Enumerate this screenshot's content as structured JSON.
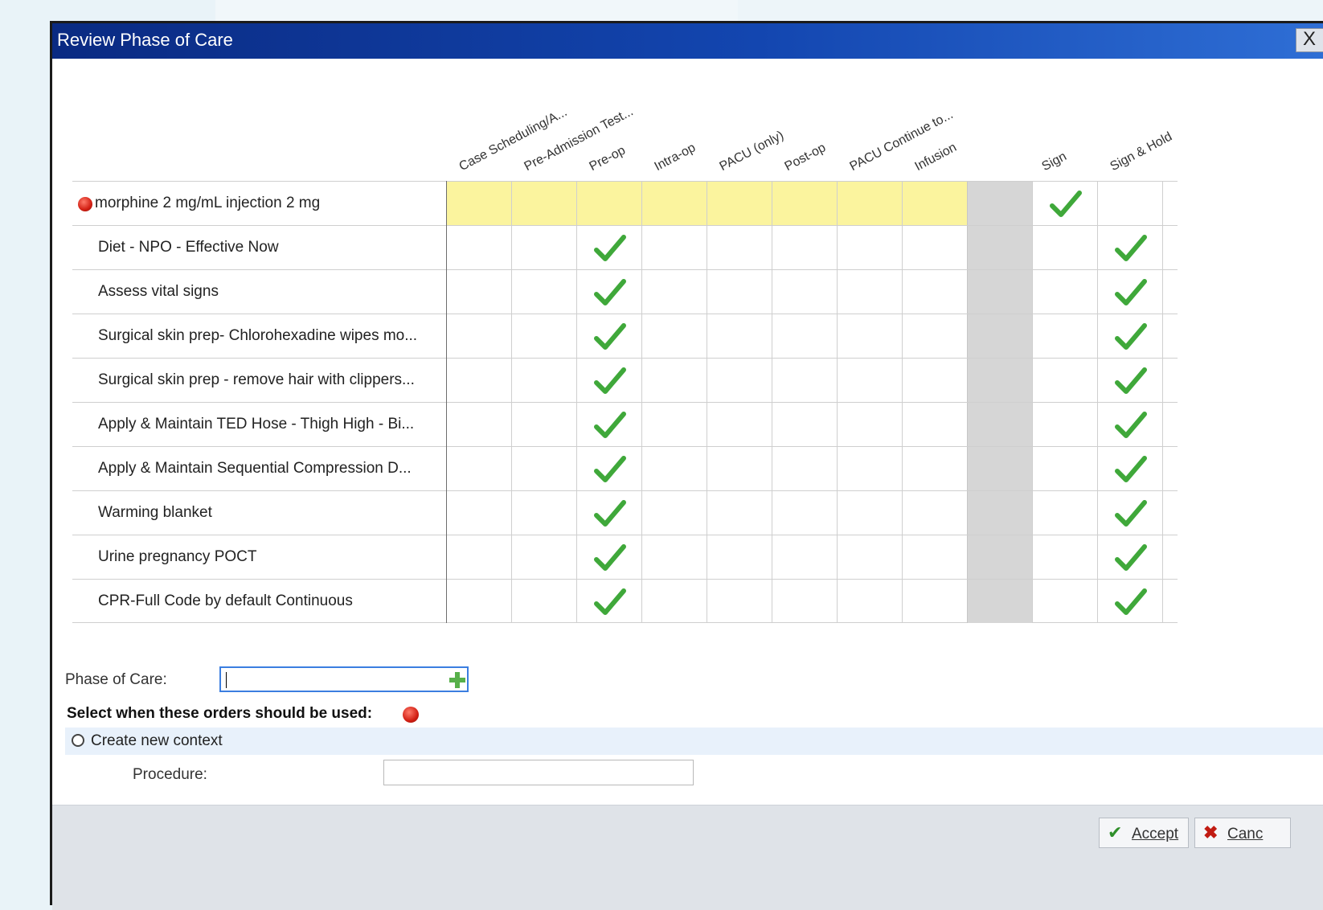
{
  "window": {
    "title": "Review Phase of Care",
    "close_label": "X"
  },
  "columns": [
    "Case Scheduling/A...",
    "Pre-Admission Test...",
    "Pre-op",
    "Intra-op",
    "PACU (only)",
    "Post-op",
    "PACU Continue to...",
    "Infusion",
    "",
    "Sign",
    "Sign & Hold"
  ],
  "rows": [
    {
      "label": "morphine 2 mg/mL injection 2 mg",
      "warning": true,
      "checks": [
        9
      ]
    },
    {
      "label": "Diet - NPO - Effective Now",
      "warning": false,
      "checks": [
        2,
        10
      ]
    },
    {
      "label": "Assess vital signs",
      "warning": false,
      "checks": [
        2,
        10
      ]
    },
    {
      "label": "Surgical skin prep- Chlorohexadine wipes mo...",
      "warning": false,
      "checks": [
        2,
        10
      ]
    },
    {
      "label": "Surgical skin prep - remove hair with clippers...",
      "warning": false,
      "checks": [
        2,
        10
      ]
    },
    {
      "label": "Apply & Maintain TED Hose - Thigh High - Bi...",
      "warning": false,
      "checks": [
        2,
        10
      ]
    },
    {
      "label": "Apply & Maintain Sequential Compression D...",
      "warning": false,
      "checks": [
        2,
        10
      ]
    },
    {
      "label": "Warming blanket",
      "warning": false,
      "checks": [
        2,
        10
      ]
    },
    {
      "label": "Urine pregnancy POCT",
      "warning": false,
      "checks": [
        2,
        10
      ]
    },
    {
      "label": "CPR-Full Code by default Continuous",
      "warning": false,
      "checks": [
        2,
        10
      ]
    }
  ],
  "form": {
    "phase_label": "Phase of Care:",
    "phase_value": "",
    "select_label": "Select when these orders should be used:",
    "create_context_label": "Create new context",
    "procedure_label": "Procedure:",
    "procedure_value": ""
  },
  "footer": {
    "accept_label": "Accept",
    "cancel_label": "Canc"
  },
  "colors": {
    "title_bar": "#1346b0",
    "highlight_row": "#fbf49e",
    "separator_column": "#d6d6d6",
    "check": "#3fa83a",
    "warning": "#d21f13"
  },
  "icons": {
    "check": "checkmark-icon",
    "warning": "error-dot-icon",
    "add": "plus-icon",
    "accept": "check-icon",
    "cancel": "x-icon"
  }
}
